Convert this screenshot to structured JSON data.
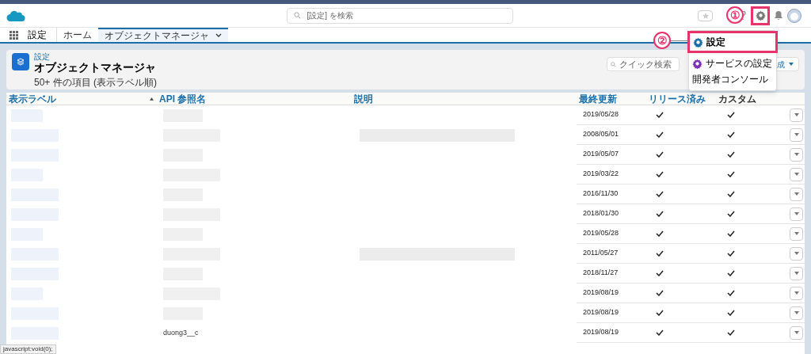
{
  "header": {
    "search": {
      "placeholder": "[設定] を検索"
    }
  },
  "nav": {
    "app_name": "設定",
    "tabs": [
      {
        "label": "ホーム",
        "selected": false,
        "has_menu": false
      },
      {
        "label": "オブジェクトマネージャ",
        "selected": true,
        "has_menu": true
      }
    ]
  },
  "page_header": {
    "breadcrumb": "設定",
    "title": "オブジェクトマネージャ",
    "subtitle": "50+ 件の項目 (表示ラベル順)",
    "quick_search": {
      "placeholder": "クイック検索"
    },
    "button": "成"
  },
  "setup_menu": {
    "items": [
      {
        "label": "設定",
        "kind": "gear",
        "color": "#1b6fa8",
        "highlighted": true
      },
      {
        "label": "サービスの設定",
        "kind": "gear",
        "color": "#7b2fb5",
        "highlighted": false
      },
      {
        "label": "開発者コンソール",
        "kind": "plain",
        "highlighted": false
      }
    ]
  },
  "annotations": [
    "①",
    "②"
  ],
  "table": {
    "columns": [
      {
        "label": "表示ラベル",
        "sorted": true
      },
      {
        "label": "API 参照名",
        "sorted": false
      },
      {
        "label": "説明",
        "sorted": false
      },
      {
        "label": "最終更新",
        "sorted": false
      },
      {
        "label": "リリース済み",
        "sorted": false
      },
      {
        "label": "カスタム",
        "sorted": false
      }
    ],
    "rows": [
      {
        "updated": "2019/05/28",
        "released": true,
        "custom": true
      },
      {
        "updated": "2008/05/01",
        "released": true,
        "custom": true
      },
      {
        "updated": "2019/05/07",
        "released": true,
        "custom": true
      },
      {
        "updated": "2019/03/22",
        "released": true,
        "custom": true
      },
      {
        "updated": "2016/11/30",
        "released": true,
        "custom": true
      },
      {
        "updated": "2018/01/30",
        "released": true,
        "custom": true
      },
      {
        "updated": "2019/05/28",
        "released": true,
        "custom": true
      },
      {
        "updated": "2011/05/27",
        "released": true,
        "custom": true
      },
      {
        "updated": "2018/11/27",
        "released": true,
        "custom": true
      },
      {
        "updated": "2019/08/19",
        "released": true,
        "custom": true
      },
      {
        "updated": "2019/08/19",
        "released": true,
        "custom": true
      },
      {
        "api_name": "duong3__c",
        "updated": "2019/08/19",
        "released": true,
        "custom": true
      }
    ]
  },
  "status_bar": "javascript:void(0);"
}
